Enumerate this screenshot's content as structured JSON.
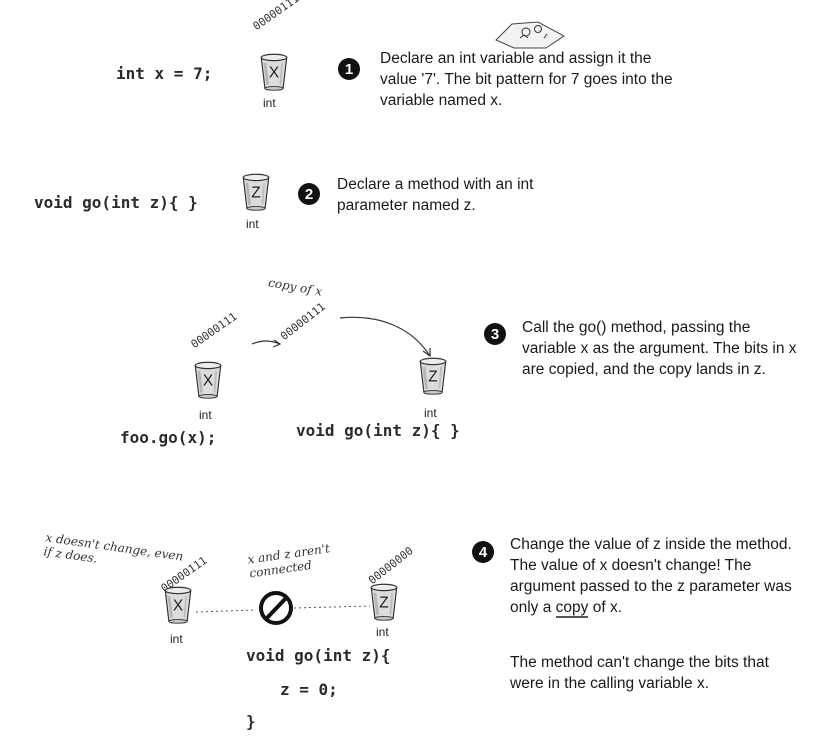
{
  "step1": {
    "code": "int x = 7;",
    "bits": "00000111",
    "cup_letter": "X",
    "type": "int",
    "number": "1",
    "description": "Declare an int variable and assign it the value '7'. The bit pattern for 7 goes into the variable named x."
  },
  "step2": {
    "code": "void go(int z){ }",
    "cup_letter": "Z",
    "type": "int",
    "number": "2",
    "description": "Declare a method with an int parameter named z."
  },
  "step3": {
    "copy_label": "copy of x",
    "bits_left": "00000111",
    "bits_mid": "00000111",
    "left_cup_letter": "X",
    "right_cup_letter": "Z",
    "left_type": "int",
    "right_type": "int",
    "left_code_prefix": "foo.go(",
    "left_code_arg": "x",
    "left_code_suffix": ");",
    "right_code": "void go(int z){ }",
    "number": "3",
    "description": "Call the go() method, passing the variable x as the argument. The bits in x are copied, and the copy lands in z."
  },
  "step4": {
    "note_left": "x doesn't change, even if z does.",
    "note_mid": "x and z aren't connected",
    "bits_left": "00000111",
    "bits_right": "00000000",
    "left_cup_letter": "X",
    "right_cup_letter": "Z",
    "left_type": "int",
    "right_type": "int",
    "code_line1": "void go(int z){",
    "code_line2": "z = 0;",
    "code_line3": "}",
    "number": "4",
    "desc_part1": "Change the value of z inside the method. The value of x doesn't change! The argument passed to the z parameter was only a ",
    "desc_copy": "copy",
    "desc_part2": " of x.",
    "description2": "The method can't change the bits that were in the calling variable x."
  }
}
